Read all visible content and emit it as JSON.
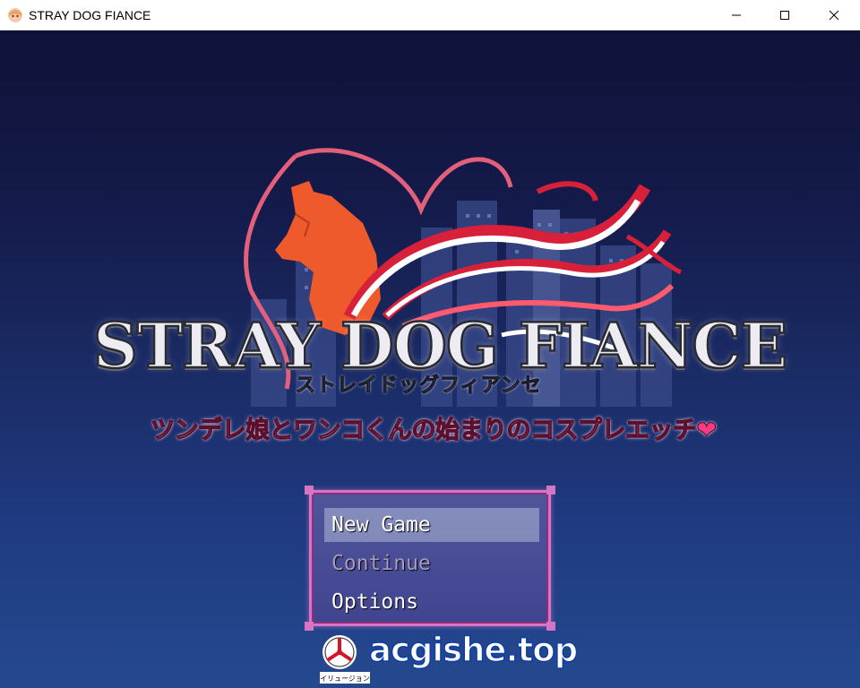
{
  "window": {
    "title": "STRAY DOG FIANCE",
    "controls": {
      "minimize": "minimize-icon",
      "maximize": "maximize-icon",
      "close": "close-icon"
    }
  },
  "logo": {
    "title": "STRAY DOG FIANCE",
    "katakana": "ストレイドッグフィアンセ",
    "subtitle": "ツンデレ娘とワンコくんの始まりのコスプレエッチ",
    "heart": "❤"
  },
  "menu": {
    "items": [
      {
        "label": "New Game",
        "state": "selected"
      },
      {
        "label": "Continue",
        "state": "disabled"
      },
      {
        "label": "Options",
        "state": "normal"
      }
    ]
  },
  "watermark": {
    "text": "acgishe.top",
    "logo_caption": "イリュージョン"
  },
  "colors": {
    "menu_border": "#d874c4",
    "subtitle_pink": "#f2a6c4",
    "dog_orange": "#f06a2a",
    "ribbon_red": "#d8203a"
  }
}
